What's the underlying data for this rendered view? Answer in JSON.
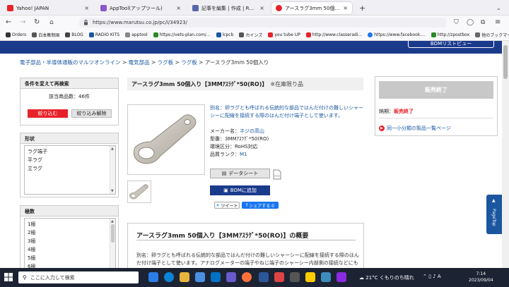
{
  "browser": {
    "tabs": [
      {
        "label": "Yahoo! JAPAN",
        "color": "#e8222a",
        "active": false
      },
      {
        "label": "AppTool(アップツール)",
        "color": "#8855cc",
        "active": false
      },
      {
        "label": "記事を編集 | 作成 | RADIO KITS",
        "color": "#5566aa",
        "active": false
      },
      {
        "label": "アースラグ3mm 50個入り 3MM7ｽﾗｸﾞ",
        "color": "#e8222a",
        "active": true
      }
    ],
    "url": "https://www.marutsu.co.jp/pc/i/34923/",
    "bookmarks": [
      {
        "label": "Orders",
        "color": "#333333"
      },
      {
        "label": "白本集制国",
        "color": "#555555"
      },
      {
        "label": "BLOG",
        "color": "#444444"
      },
      {
        "label": "RADIO KITS",
        "color": "#1a57a0"
      },
      {
        "label": "apptool",
        "color": "#888888"
      },
      {
        "label": "https://vets-plan.com/...",
        "color": "#2a8a2a"
      },
      {
        "label": "lcpcb",
        "color": "#1a57a0"
      },
      {
        "label": "カインズ",
        "color": "#555555"
      },
      {
        "label": "you tube UP",
        "color": "#e8222a"
      },
      {
        "label": "http://www.classeradi...",
        "color": "#e8222a"
      },
      {
        "label": "https://www.facebook....",
        "color": "#1877f2"
      },
      {
        "label": "http://zpostbox",
        "color": "#2a8a2a"
      },
      {
        "label": "他のブックマーク",
        "color": "#666666"
      }
    ]
  },
  "site": {
    "bom_label": "BOMリストビュー",
    "breadcrumb": [
      "電子部品・半導体通販のマルツオンライン",
      "電気部品",
      "ラグ板",
      "ラグ板"
    ],
    "breadcrumb_current": "アースラグ3mm 50個入り",
    "breadcrumb_sep": ">",
    "filter": {
      "title": "条件を変えて再検索",
      "result": "該当商品数：46件",
      "apply": "絞り込む",
      "reset": "絞り込み解除"
    },
    "shape": {
      "title": "形状",
      "options": [
        "ラグ端子",
        "平ラグ",
        "立ラグ"
      ]
    },
    "poles": {
      "title": "極数",
      "options": [
        "1極",
        "2極",
        "3極",
        "4極",
        "5極",
        "6極"
      ]
    },
    "product": {
      "title": "アースラグ3mm 50個入り【3MMｱｽﾗｸﾞ*50(RO)】",
      "stock_note": "※在庫限り品",
      "description": "別名：卵ラグとも呼ばれる伝統的な部品ではんだ付けの難しいシャーシーに配線を接続する際のはんだ付け端子として使います。",
      "specs": [
        {
          "label": "メーカー名：",
          "value": "ネジの高山",
          "link": true
        },
        {
          "label": "型番：",
          "value": "3MMｱｽﾗｸﾞ*50(RO)",
          "link": false
        },
        {
          "label": "環境区分：",
          "value": "RoHS対応",
          "link": false
        },
        {
          "label": "品質ランク：",
          "value": "M1",
          "link": true
        }
      ],
      "datasheet": "データシート",
      "bom_add": "BOMに追加",
      "tweet": "ツイート",
      "share": "シェアする 0"
    },
    "overview": {
      "title": "アースラグ3mm 50個入り【3MMｱｽﾗｸﾞ*50(RO)】の概要",
      "text": "別名：卵ラグとも呼ばれる伝統的な部品ではんだ付けの難しいシャーシーに配線を接続する際のはんだ付け端子として使います。アナログメーターの端子やねじ端子のシャーシー内部側の接続などにも使われています。（ネジの穴径にご注意ください。）"
    },
    "purchase": {
      "sold_out": "販売終了",
      "delivery_label": "納期：",
      "delivery_value": "販売終了",
      "same_category": "同一小分類の製品一覧ページ"
    },
    "pagetop": "PageTop"
  },
  "taskbar": {
    "search_placeholder": "ここに入力して検索",
    "weather": "21°C くもりのち晴れ",
    "clock_time": "7:14",
    "clock_date": "2023/09/04"
  }
}
